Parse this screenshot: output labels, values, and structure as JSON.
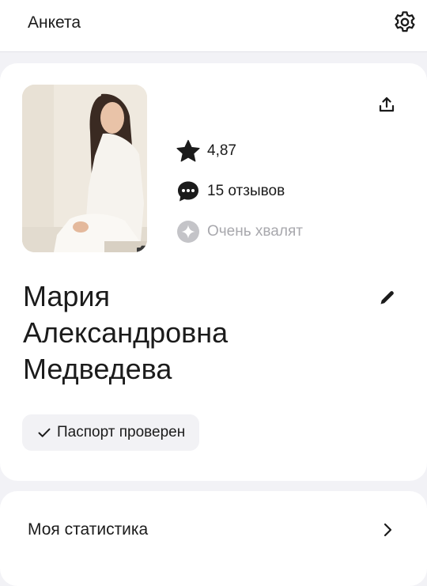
{
  "header": {
    "title": "Анкета",
    "settings_icon": "gear-icon"
  },
  "profile": {
    "photo_icon": "camera-icon",
    "share_icon": "share-icon",
    "edit_icon": "pencil-icon",
    "stats": {
      "rating": "4,87",
      "reviews": "15 отзывов",
      "praise": "Очень хвалят"
    },
    "name_lines": [
      "Мария",
      "Александровна",
      "Медведева"
    ],
    "badge": "Паспорт проверен"
  },
  "statistics": {
    "label": "Моя статистика"
  },
  "colors": {
    "background": "#f2f2f6",
    "card": "#ffffff",
    "text": "#1b1b1b",
    "muted": "#a8a8ad",
    "badge_bg": "#f2f2f5"
  }
}
